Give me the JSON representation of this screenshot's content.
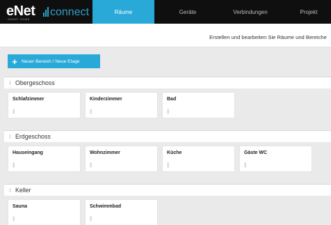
{
  "brand": {
    "logo_text": "eNet",
    "tagline": "SMART HOME",
    "product": "connect",
    "accent": "#29a9d8"
  },
  "nav": {
    "tabs": [
      {
        "label": "Räume",
        "active": true
      },
      {
        "label": "Geräte",
        "active": false
      },
      {
        "label": "Verbindungen",
        "active": false
      },
      {
        "label": "Projekt",
        "active": false
      }
    ]
  },
  "header": {
    "subtitle": "Erstellen und bearbeiten Sie Räume und Bereiche"
  },
  "toolbar": {
    "add_area_label": "Neuer Bereich / Neue Etage",
    "add_icon": "plus-icon"
  },
  "sections": [
    {
      "name": "Obergeschoss",
      "rooms": [
        "Schlafzimmer",
        "Kinderzimmer",
        "Bad"
      ]
    },
    {
      "name": "Erdgeschoss",
      "rooms": [
        "Hauseingang",
        "Wohnzimmer",
        "Küche",
        "Gäste WC"
      ]
    },
    {
      "name": "Keller",
      "rooms": [
        "Sauna",
        "Schwimmbad"
      ]
    }
  ],
  "icons": {
    "section_handle": "drag-handle-icon",
    "card_handle": "drag-handle-icon"
  }
}
